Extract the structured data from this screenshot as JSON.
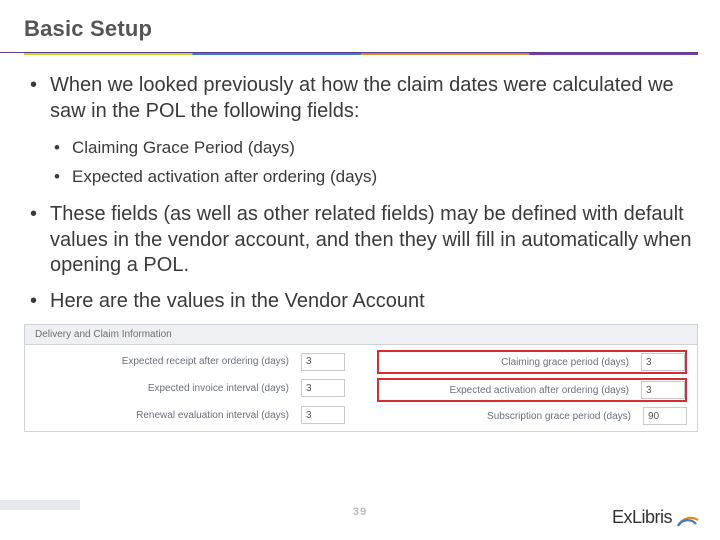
{
  "title": "Basic Setup",
  "bullets": {
    "b1": "When we looked previously at how the claim dates were calculated we saw in the POL the following fields:",
    "b1a": "Claiming Grace Period (days)",
    "b1b": "Expected activation after ordering (days)",
    "b2": "These fields (as well as other related fields) may be defined with default values in the vendor account, and then they will fill in automatically when opening a POL.",
    "b3": "Here are the values in the Vendor Account"
  },
  "panel": {
    "heading": "Delivery and Claim Information",
    "left": {
      "l1": {
        "label": "Expected receipt after ordering (days)",
        "value": "3"
      },
      "l2": {
        "label": "Expected invoice interval (days)",
        "value": "3"
      },
      "l3": {
        "label": "Renewal evaluation interval (days)",
        "value": "3"
      }
    },
    "right": {
      "r1": {
        "label": "Claiming grace period (days)",
        "value": "3"
      },
      "r2": {
        "label": "Expected activation after ordering (days)",
        "value": "3"
      },
      "r3": {
        "label": "Subscription grace period (days)",
        "value": "90"
      }
    }
  },
  "page_number": "39",
  "brand": "ExLibris"
}
